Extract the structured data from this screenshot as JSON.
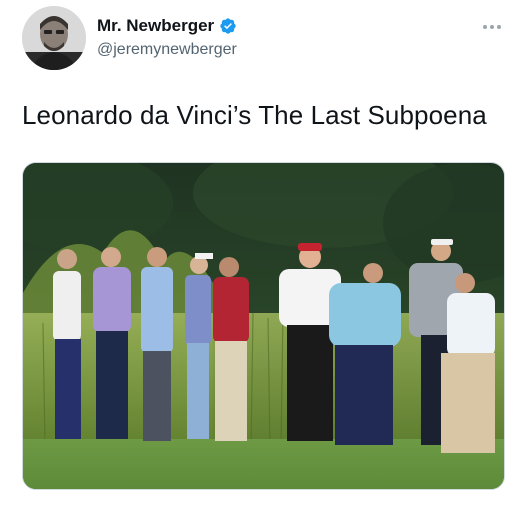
{
  "author": {
    "display_name": "Mr. Newberger",
    "handle": "@jeremynewberger",
    "verified": true,
    "avatar_icon": "profile-photo"
  },
  "tweet": {
    "text": "Leonardo da Vinci’s The Last Subpoena"
  },
  "media": {
    "type": "photo",
    "description_icon": "golf-course-group-photo"
  },
  "colors": {
    "verified_blue": "#1d9bf0",
    "text_primary": "#0f1419",
    "text_secondary": "#536471"
  }
}
